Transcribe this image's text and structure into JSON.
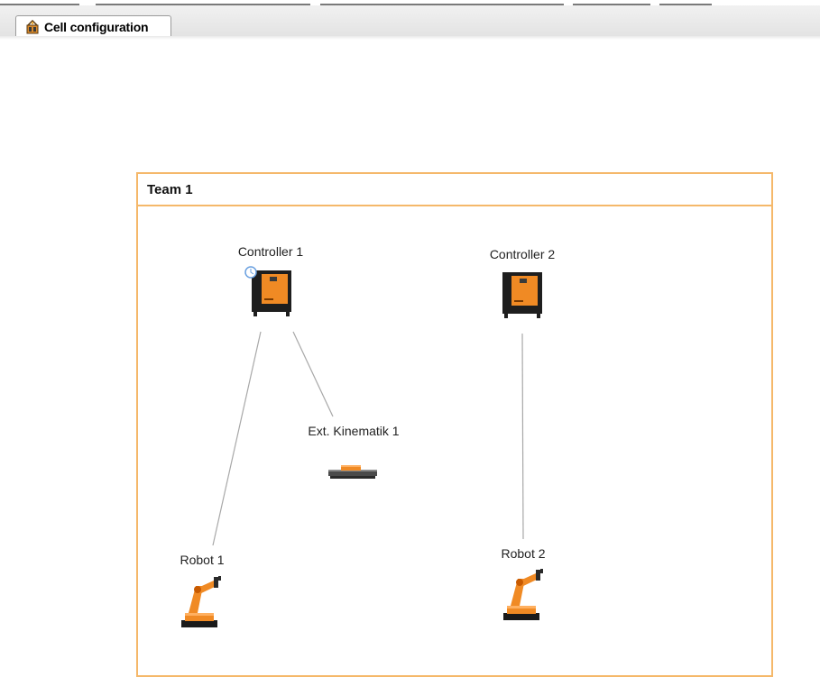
{
  "tab": {
    "label": "Cell configuration",
    "icon": "cell-configuration-icon"
  },
  "team": {
    "title": "Team 1",
    "border_color": "#f5b86a"
  },
  "nodes": {
    "controller1": {
      "label": "Controller 1",
      "icon": "controller-cabinet-icon"
    },
    "controller2": {
      "label": "Controller 2",
      "icon": "controller-cabinet-icon"
    },
    "extkin1": {
      "label": "Ext. Kinematik 1",
      "icon": "linear-track-icon"
    },
    "robot1": {
      "label": "Robot 1",
      "icon": "industrial-robot-icon"
    },
    "robot2": {
      "label": "Robot 2",
      "icon": "industrial-robot-icon"
    }
  },
  "colors": {
    "accent_orange": "#f08a24",
    "cabinet_dark": "#1e1e1e",
    "connection_line": "#a8a8a8"
  }
}
